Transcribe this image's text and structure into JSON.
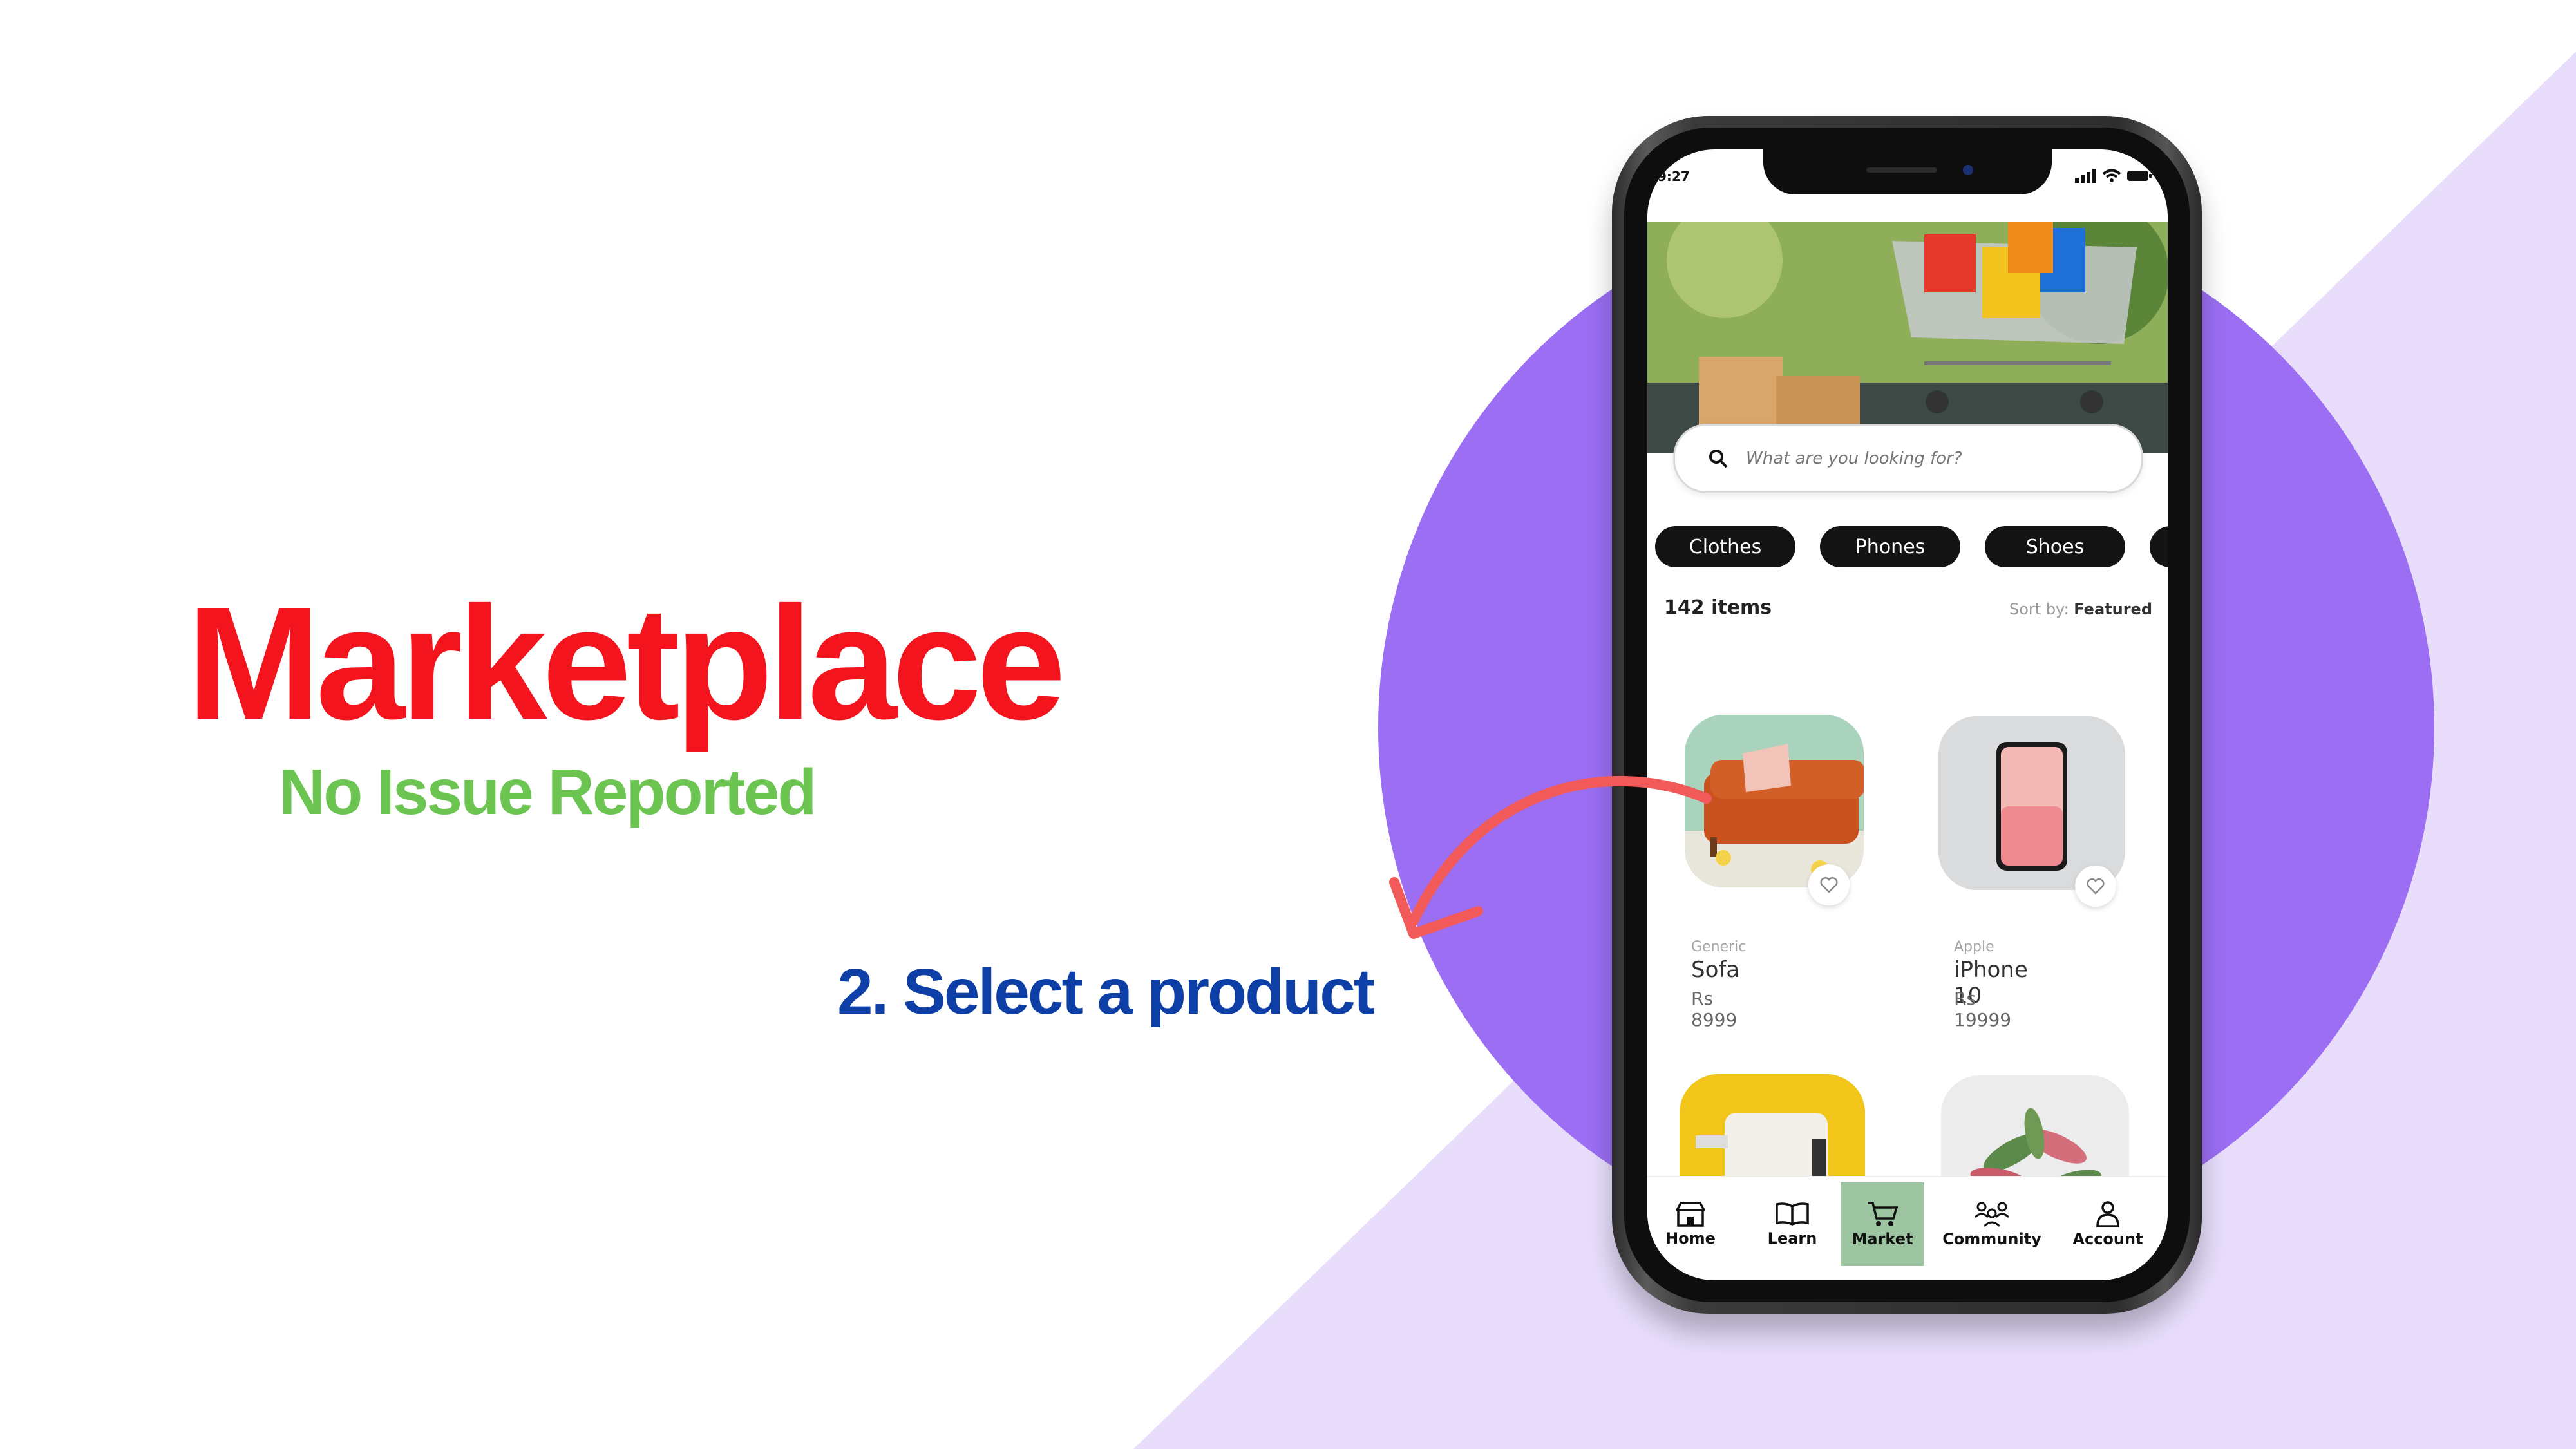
{
  "slide": {
    "title": "Marketplace",
    "subtitle": "No Issue Reported",
    "step_text": "2. Select a product",
    "colors": {
      "title": "#f4141e",
      "subtitle": "#6cc551",
      "step": "#0d3fa6",
      "circle": "#9b6ef3",
      "lavender": "#e8defc",
      "arrow": "#f25a5a"
    }
  },
  "phone": {
    "status_time": "9:27",
    "status_icons": [
      "signal-icon",
      "wifi-icon",
      "battery-icon"
    ],
    "search": {
      "placeholder": "What are you looking for?"
    },
    "categories": [
      "Clothes",
      "Phones",
      "Shoes"
    ],
    "item_count": "142 items",
    "sort_label": "Sort by:",
    "sort_value": "Featured",
    "products": [
      {
        "brand": "Generic",
        "name": "Sofa",
        "price": "Rs 8999"
      },
      {
        "brand": "Apple",
        "name": "iPhone 10",
        "price": "Rs 19999"
      }
    ],
    "tabs": [
      {
        "label": "Home",
        "icon": "store-icon"
      },
      {
        "label": "Learn",
        "icon": "book-icon"
      },
      {
        "label": "Market",
        "icon": "cart-icon",
        "active": true
      },
      {
        "label": "Community",
        "icon": "people-icon"
      },
      {
        "label": "Account",
        "icon": "user-icon"
      }
    ]
  }
}
